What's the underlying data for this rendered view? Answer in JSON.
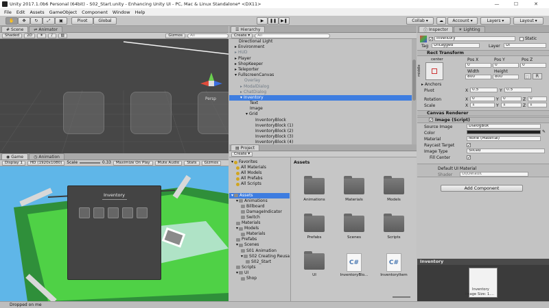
{
  "window": {
    "title": "Unity 2017.1.0b6 Personal (64bit) - S02_Start.unity - Enhancing Unity UI - PC, Mac & Linux Standalone* <DX11>",
    "minimize": "—",
    "maximize": "☐",
    "close": "✕"
  },
  "menu": [
    "File",
    "Edit",
    "Assets",
    "GameObject",
    "Component",
    "Window",
    "Help"
  ],
  "toolbar": {
    "pivot": "Pivot",
    "global": "Global",
    "collab": "Collab",
    "account": "Account",
    "layers": "Layers",
    "layout": "Layout"
  },
  "scene": {
    "tabs": [
      "Scene",
      "Animator"
    ],
    "shading": "Shaded",
    "mode": "2D",
    "gizmos": "Gizmos",
    "search": "All",
    "persp": "Persp"
  },
  "game": {
    "tabs": [
      "Game",
      "Animation"
    ],
    "display": "Display 1",
    "resolution": "HD (1920x1080)",
    "scale_label": "Scale",
    "scale_value": "0.33",
    "options": [
      "Maximize On Play",
      "Mute Audio",
      "Stats",
      "Gizmos"
    ],
    "window_title": "Inventory"
  },
  "hierarchy": {
    "tab": "Hierarchy",
    "create": "Create",
    "search": "All",
    "items": [
      {
        "label": "Directional Light",
        "indent": 0,
        "state": "normal"
      },
      {
        "label": "Environment",
        "indent": 0,
        "arrow": "▸",
        "state": "normal"
      },
      {
        "label": "HUD",
        "indent": 0,
        "arrow": "▸",
        "state": "dim"
      },
      {
        "label": "Player",
        "indent": 0,
        "arrow": "▸",
        "state": "normal"
      },
      {
        "label": "ShopKeeper",
        "indent": 0,
        "arrow": "▸",
        "state": "normal"
      },
      {
        "label": "Teleporter",
        "indent": 0,
        "arrow": "▸",
        "state": "normal"
      },
      {
        "label": "FullscreenCanvas",
        "indent": 0,
        "arrow": "▾",
        "state": "normal"
      },
      {
        "label": "Overlay",
        "indent": 1,
        "state": "dim"
      },
      {
        "label": "ModalDialog",
        "indent": 1,
        "arrow": "▸",
        "state": "dim"
      },
      {
        "label": "ChatDialog",
        "indent": 1,
        "arrow": "▸",
        "state": "dim"
      },
      {
        "label": "Inventory",
        "indent": 1,
        "arrow": "▾",
        "state": "sel"
      },
      {
        "label": "Text",
        "indent": 2,
        "state": "normal"
      },
      {
        "label": "Image",
        "indent": 2,
        "state": "normal"
      },
      {
        "label": "Grid",
        "indent": 2,
        "arrow": "▾",
        "state": "normal"
      },
      {
        "label": "InventoryBlock",
        "indent": 3,
        "state": "normal"
      },
      {
        "label": "InventoryBlock (1)",
        "indent": 3,
        "state": "normal"
      },
      {
        "label": "InventoryBlock (2)",
        "indent": 3,
        "state": "normal"
      },
      {
        "label": "InventoryBlock (3)",
        "indent": 3,
        "state": "normal"
      },
      {
        "label": "InventoryBlock (4)",
        "indent": 3,
        "state": "normal"
      }
    ]
  },
  "project": {
    "tab": "Project",
    "create": "Create",
    "assets_header": "Assets",
    "tree": [
      {
        "label": "Favorites",
        "indent": 0,
        "arrow": "▾",
        "kind": "star",
        "state": "normal"
      },
      {
        "label": "All Materials",
        "indent": 1,
        "kind": "star",
        "state": "normal"
      },
      {
        "label": "All Models",
        "indent": 1,
        "kind": "star",
        "state": "normal"
      },
      {
        "label": "All Prefabs",
        "indent": 1,
        "kind": "star",
        "state": "normal"
      },
      {
        "label": "All Scripts",
        "indent": 1,
        "kind": "star",
        "state": "normal"
      },
      {
        "label": "",
        "indent": 0,
        "kind": "none",
        "state": "normal"
      },
      {
        "label": "Assets",
        "indent": 0,
        "arrow": "▾",
        "kind": "folder",
        "state": "sel"
      },
      {
        "label": "Animations",
        "indent": 1,
        "arrow": "▾",
        "kind": "folder",
        "state": "normal"
      },
      {
        "label": "Billboard",
        "indent": 2,
        "kind": "folder",
        "state": "normal"
      },
      {
        "label": "DamageIndicator",
        "indent": 2,
        "kind": "folder",
        "state": "normal"
      },
      {
        "label": "Switch",
        "indent": 2,
        "kind": "folder",
        "state": "normal"
      },
      {
        "label": "Materials",
        "indent": 1,
        "kind": "folder",
        "state": "normal"
      },
      {
        "label": "Models",
        "indent": 1,
        "arrow": "▾",
        "kind": "folder",
        "state": "normal"
      },
      {
        "label": "Materials",
        "indent": 2,
        "kind": "folder",
        "state": "normal"
      },
      {
        "label": "Prefabs",
        "indent": 1,
        "kind": "folder",
        "state": "normal"
      },
      {
        "label": "Scenes",
        "indent": 1,
        "arrow": "▾",
        "kind": "folder",
        "state": "normal"
      },
      {
        "label": "S01 Animation",
        "indent": 2,
        "kind": "folder",
        "state": "normal"
      },
      {
        "label": "S02 Creating Reusa",
        "indent": 2,
        "arrow": "▾",
        "kind": "folder",
        "state": "normal"
      },
      {
        "label": "S02_Start",
        "indent": 3,
        "kind": "folder",
        "state": "normal"
      },
      {
        "label": "Scripts",
        "indent": 1,
        "kind": "folder",
        "state": "normal"
      },
      {
        "label": "UI",
        "indent": 1,
        "arrow": "▾",
        "kind": "folder",
        "state": "normal"
      },
      {
        "label": "Shop",
        "indent": 2,
        "kind": "folder",
        "state": "normal"
      }
    ],
    "assets": [
      {
        "label": "Animations",
        "kind": "folder"
      },
      {
        "label": "Materials",
        "kind": "folder"
      },
      {
        "label": "Models",
        "kind": "folder"
      },
      {
        "label": "Prefabs",
        "kind": "folder"
      },
      {
        "label": "Scenes",
        "kind": "folder"
      },
      {
        "label": "Scripts",
        "kind": "folder"
      },
      {
        "label": "UI",
        "kind": "folder"
      },
      {
        "label": "InventoryBlo...",
        "kind": "script"
      },
      {
        "label": "InventoryItem",
        "kind": "script"
      }
    ]
  },
  "inspector": {
    "tabs": [
      "Inspector",
      "Lighting"
    ],
    "object_name": "Inventory",
    "static": "Static",
    "tag_label": "Tag",
    "tag_value": "Untagged",
    "layer_label": "Layer",
    "layer_value": "UI",
    "rect": {
      "title": "Rect Transform",
      "anchor_preset": "center",
      "side_label": "middle",
      "pos_x_label": "Pos X",
      "pos_y_label": "Pos Y",
      "pos_z_label": "Pos Z",
      "pos_x": "0",
      "pos_y": "0",
      "pos_z": "0",
      "width_label": "Width",
      "height_label": "Height",
      "width": "800",
      "height": "800",
      "r_button": "R",
      "anchors": "Anchors",
      "pivot_label": "Pivot",
      "pivot_x": "0.5",
      "pivot_y": "0.5",
      "rotation_label": "Rotation",
      "rot_x": "0",
      "rot_y": "0",
      "rot_z": "0",
      "scale_label": "Scale",
      "scale_x": "1",
      "scale_y": "1",
      "scale_z": "1"
    },
    "canvas_renderer": "Canvas Renderer",
    "image": {
      "title": "Image (Script)",
      "source_label": "Source Image",
      "source_value": "DialogBox",
      "color_label": "Color",
      "material_label": "Material",
      "material_value": "None (Material)",
      "raycast_label": "Raycast Target",
      "type_label": "Image Type",
      "type_value": "Sliced",
      "fill_label": "Fill Center"
    },
    "default_material": "Default UI Material",
    "shader_label": "Shader",
    "shader_value": "UI/Default",
    "add_component": "Add Component"
  },
  "preview": {
    "title": "Inventory",
    "caption_line1": "Inventory",
    "caption_line2": "Image Size: 1...."
  },
  "status": {
    "message": "Dropped on me"
  },
  "colors": {
    "selection": "#3e7de0",
    "scene_bg": "#474747",
    "sky": "#5fb6e8",
    "grass": "#4fd146"
  }
}
